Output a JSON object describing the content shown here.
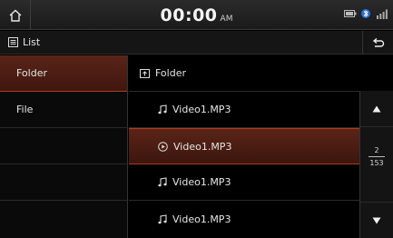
{
  "status": {
    "time": "00:00",
    "ampm": "AM"
  },
  "titlebar": {
    "title": "List"
  },
  "left_menu": [
    {
      "label": "Folder",
      "selected": true
    },
    {
      "label": "File",
      "selected": false
    }
  ],
  "list": {
    "header": "Folder",
    "rows": [
      {
        "label": "Video1.MP3",
        "icon": "music-note-icon",
        "selected": false
      },
      {
        "label": "Video1.MP3",
        "icon": "play-circle-icon",
        "selected": true
      },
      {
        "label": "Video1.MP3",
        "icon": "music-note-icon",
        "selected": false
      },
      {
        "label": "Video1.MP3",
        "icon": "music-note-icon",
        "selected": false
      }
    ]
  },
  "pager": {
    "current": "2",
    "total": "153"
  },
  "colors": {
    "accent": "#b23a1c",
    "selected_bg": "#5a2418"
  }
}
